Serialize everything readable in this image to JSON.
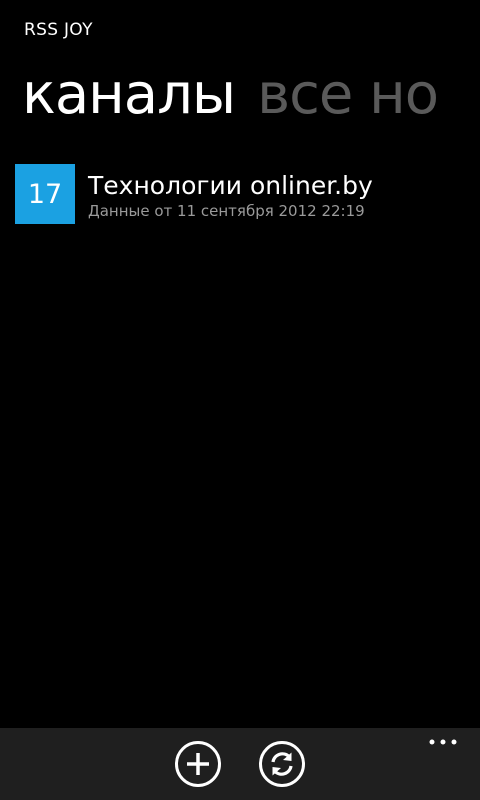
{
  "app": {
    "title": "RSS JOY"
  },
  "pivot": {
    "items": [
      {
        "label": "каналы",
        "active": true
      },
      {
        "label": "все но",
        "active": false
      }
    ]
  },
  "feeds": [
    {
      "count": "17",
      "title": "Технологии onliner.by",
      "updated": "Данные от 11 сентября 2012 22:19"
    }
  ],
  "app_bar": {
    "buttons": [
      {
        "icon": "add-icon"
      },
      {
        "icon": "refresh-icon"
      }
    ],
    "more_icon": "ellipsis-icon"
  },
  "colors": {
    "background": "#000000",
    "accent": "#1ba1e2",
    "inactive_header": "#5a5a5a",
    "secondary_text": "#9a9a9a",
    "app_bar": "#1f1f1f"
  }
}
